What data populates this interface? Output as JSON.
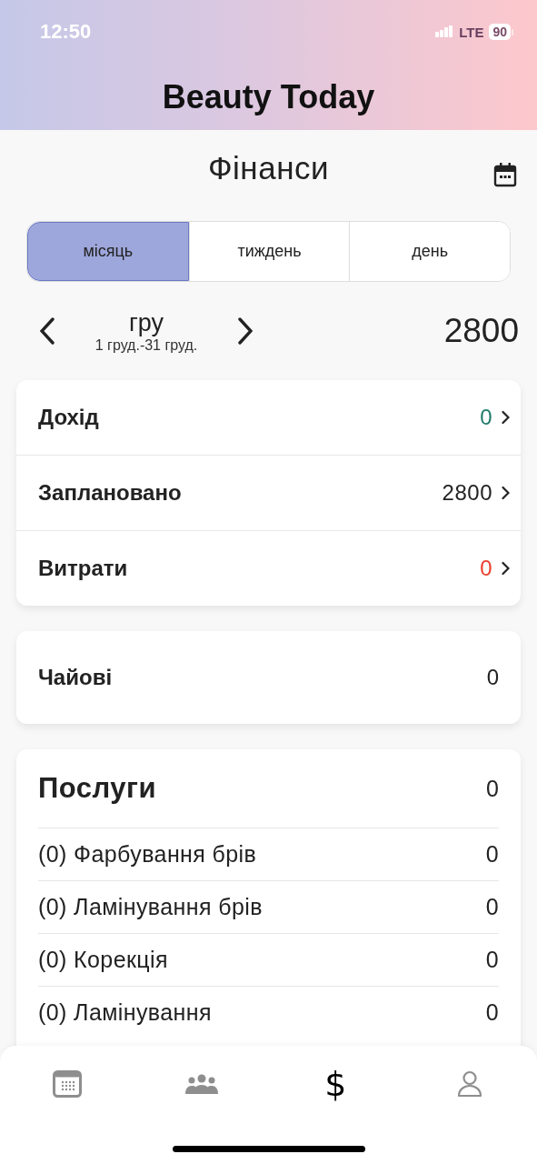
{
  "status_bar": {
    "time": "12:50",
    "network": "LTE",
    "battery": "90"
  },
  "app_title": "Beauty Today",
  "page_title": "Фінанси",
  "period_tabs": [
    {
      "label": "місяць",
      "selected": true
    },
    {
      "label": "тиждень",
      "selected": false
    },
    {
      "label": "день",
      "selected": false
    }
  ],
  "period": {
    "month": "гру",
    "range": "1 груд.-31 груд.",
    "total": "2800"
  },
  "summary": [
    {
      "label": "Дохід",
      "value": "0",
      "color": "#1f7a6a"
    },
    {
      "label": "Заплановано",
      "value": "2800",
      "color": "#222222"
    },
    {
      "label": "Витрати",
      "value": "0",
      "color": "#e8402f"
    }
  ],
  "tips": {
    "label": "Чайові",
    "value": "0"
  },
  "services": {
    "title": "Послуги",
    "total": "0",
    "items": [
      {
        "name": "(0) Фарбування брів",
        "value": "0"
      },
      {
        "name": "(0) Ламінування брів",
        "value": "0"
      },
      {
        "name": "(0) Корекція",
        "value": "0"
      },
      {
        "name": "(0) Ламінування",
        "value": "0"
      }
    ]
  },
  "tab_bar": [
    {
      "kind": "calendar",
      "selected": false
    },
    {
      "kind": "clients",
      "selected": false
    },
    {
      "kind": "money",
      "label": "$",
      "selected": true
    },
    {
      "kind": "profile",
      "selected": false
    }
  ]
}
